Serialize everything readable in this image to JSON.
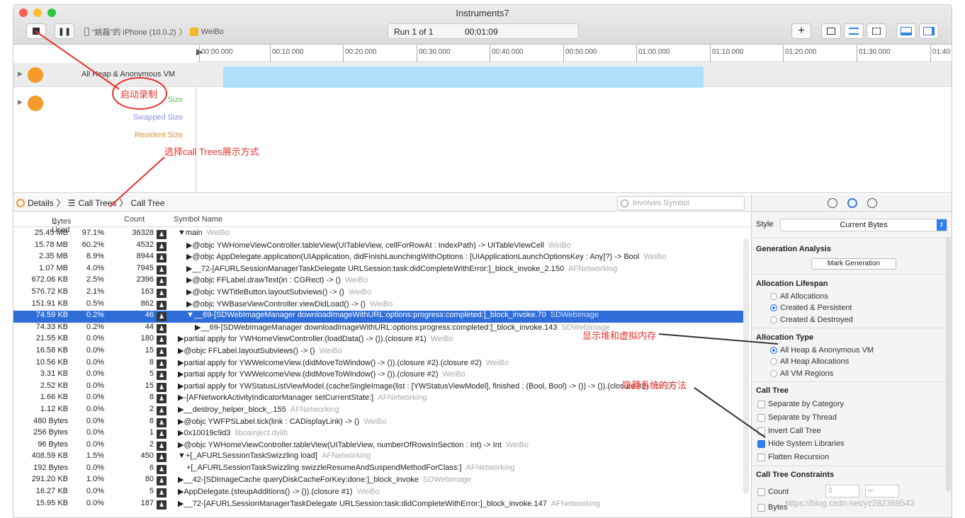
{
  "window": {
    "title": "Instruments7"
  },
  "toolbar": {
    "device": "“姚磊”的 iPhone (10.0.2)",
    "process": "WeiBo",
    "run_label": "Run 1 of 1",
    "timer": "00:01:09"
  },
  "ruler": {
    "ticks": [
      "00:00.000",
      "00:10.000",
      "00:20.000",
      "00:30.000",
      "00:40.000",
      "00:50.000",
      "01:00.000",
      "01:10.000",
      "01:20.000",
      "01:30.000",
      "01:40"
    ]
  },
  "tracks": {
    "main_track": "All Heap & Anonymous VM",
    "sub_labels": [
      "Size",
      "Swapped Size",
      "Resident Size"
    ]
  },
  "annotations": {
    "record": "启动录制",
    "call_trees": "选择call Trees展示方式",
    "heap": "显示堆和虚拟内存",
    "hide_system": "隐藏系统的方法"
  },
  "jumpbar": {
    "details": "Details",
    "call_trees": "Call Trees",
    "call_tree": "Call Tree",
    "search_placeholder": "Involves Symbol"
  },
  "columns": {
    "bytes": "Bytes Used",
    "count": "Count",
    "symbol": "Symbol Name"
  },
  "rows": [
    {
      "bytes": "25.45 MB",
      "pct": "97.1%",
      "count": "36328",
      "sym": "▼main",
      "lib": "WeiBo",
      "indent": 0
    },
    {
      "bytes": "15.78 MB",
      "pct": "60.2%",
      "count": "4532",
      "sym": "▶@objc YWHomeViewController.tableView(UITableView, cellForRowAt : IndexPath) -> UITableViewCell",
      "lib": "WeiBo",
      "indent": 1
    },
    {
      "bytes": "2.35 MB",
      "pct": "8.9%",
      "count": "8944",
      "sym": "▶@objc AppDelegate.application(UIApplication, didFinishLaunchingWithOptions : [UIApplicationLaunchOptionsKey : Any]?) -> Bool",
      "lib": "WeiBo",
      "indent": 1
    },
    {
      "bytes": "1.07 MB",
      "pct": "4.0%",
      "count": "7945",
      "sym": "▶__72-[AFURLSessionManagerTaskDelegate URLSession:task:didCompleteWithError:]_block_invoke_2.150",
      "lib": "AFNetworking",
      "indent": 1
    },
    {
      "bytes": "672.06 KB",
      "pct": "2.5%",
      "count": "2396",
      "sym": "▶@objc FFLabel.drawText(in : CGRect) -> ()",
      "lib": "WeiBo",
      "indent": 1
    },
    {
      "bytes": "576.72 KB",
      "pct": "2.1%",
      "count": "163",
      "sym": "▶@objc YWTitleButton.layoutSubviews() -> ()",
      "lib": "WeiBo",
      "indent": 1
    },
    {
      "bytes": "151.91 KB",
      "pct": "0.5%",
      "count": "862",
      "sym": "▶@objc YWBaseViewController.viewDidLoad() -> ()",
      "lib": "WeiBo",
      "indent": 1
    },
    {
      "bytes": "74.59 KB",
      "pct": "0.2%",
      "count": "46",
      "sym": "▼__69-[SDWebImageManager downloadImageWithURL:options:progress:completed:]_block_invoke.70",
      "lib": "SDWebImage",
      "indent": 1,
      "sel": true
    },
    {
      "bytes": "74.33 KB",
      "pct": "0.2%",
      "count": "44",
      "sym": "▶__69-[SDWebImageManager downloadImageWithURL:options:progress:completed:]_block_invoke.143",
      "lib": "SDWebImage",
      "indent": 2
    },
    {
      "bytes": "21.55 KB",
      "pct": "0.0%",
      "count": "180",
      "sym": "▶partial apply for YWHomeViewController.(loadData() -> ()).(closure #1)",
      "lib": "WeiBo",
      "indent": 0
    },
    {
      "bytes": "16.58 KB",
      "pct": "0.0%",
      "count": "15",
      "sym": "▶@objc FFLabel.layoutSubviews() -> ()",
      "lib": "WeiBo",
      "indent": 0
    },
    {
      "bytes": "10.56 KB",
      "pct": "0.0%",
      "count": "8",
      "sym": "▶partial apply for YWWelcomeView.(didMoveToWindow() -> ()).(closure #2).(closure #2)",
      "lib": "WeiBo",
      "indent": 0
    },
    {
      "bytes": "3.31 KB",
      "pct": "0.0%",
      "count": "5",
      "sym": "▶partial apply for YWWelcomeView.(didMoveToWindow() -> ()).(closure #2)",
      "lib": "WeiBo",
      "indent": 0
    },
    {
      "bytes": "2.52 KB",
      "pct": "0.0%",
      "count": "15",
      "sym": "▶partial apply for YWStatusListViewModel.(cacheSingleImage(list : [YWStatusViewModel], finished : (Bool, Bool) -> ()) -> ()).(closure #2)",
      "lib": "WeiBo",
      "indent": 0
    },
    {
      "bytes": "1.66 KB",
      "pct": "0.0%",
      "count": "8",
      "sym": "▶-[AFNetworkActivityIndicatorManager setCurrentState:]",
      "lib": "AFNetworking",
      "indent": 0
    },
    {
      "bytes": "1.12 KB",
      "pct": "0.0%",
      "count": "2",
      "sym": "▶__destroy_helper_block_.155",
      "lib": "AFNetworking",
      "indent": 0
    },
    {
      "bytes": "480 Bytes",
      "pct": "0.0%",
      "count": "8",
      "sym": "▶@objc YWFPSLabel.tick(link : CADisplayLink) -> ()",
      "lib": "WeiBo",
      "indent": 0
    },
    {
      "bytes": "256 Bytes",
      "pct": "0.0%",
      "count": "1",
      "sym": "▶0x10019c9d3",
      "lib": "liboainject.dylib",
      "indent": 0
    },
    {
      "bytes": "96 Bytes",
      "pct": "0.0%",
      "count": "2",
      "sym": "▶@objc YWHomeViewController.tableView(UITableView, numberOfRowsInSection : Int) -> Int",
      "lib": "WeiBo",
      "indent": 0
    },
    {
      "bytes": "408.59 KB",
      "pct": "1.5%",
      "count": "450",
      "sym": "▼+[_AFURLSessionTaskSwizzling load]",
      "lib": "AFNetworking",
      "indent": 0
    },
    {
      "bytes": "192 Bytes",
      "pct": "0.0%",
      "count": "6",
      "sym": "+[_AFURLSessionTaskSwizzling swizzleResumeAndSuspendMethodForClass:]",
      "lib": "AFNetworking",
      "indent": 1
    },
    {
      "bytes": "291.20 KB",
      "pct": "1.0%",
      "count": "80",
      "sym": "▶__42-[SDImageCache queryDiskCacheForKey:done:]_block_invoke",
      "lib": "SDWebImage",
      "indent": 0
    },
    {
      "bytes": "16.27 KB",
      "pct": "0.0%",
      "count": "5",
      "sym": "▶AppDelegate.(steupAdditions() -> ()).(closure #1)",
      "lib": "WeiBo",
      "indent": 0
    },
    {
      "bytes": "15.95 KB",
      "pct": "0.0%",
      "count": "187",
      "sym": "▶__72-[AFURLSessionManagerTaskDelegate URLSession:task:didCompleteWithError:]_block_invoke.147",
      "lib": "AFNetworking",
      "indent": 0
    }
  ],
  "inspector": {
    "style_label": "Style",
    "style_value": "Current Bytes",
    "gen_title": "Generation Analysis",
    "mark_generation": "Mark Generation",
    "lifespan_title": "Allocation Lifespan",
    "lifespan": [
      "All Allocations",
      "Created & Persistent",
      "Created & Destroyed"
    ],
    "type_title": "Allocation Type",
    "types": [
      "All Heap & Anonymous VM",
      "All Heap Allocations",
      "All VM Regions"
    ],
    "calltree_title": "Call Tree",
    "calltree_opts": [
      "Separate by Category",
      "Separate by Thread",
      "Invert Call Tree",
      "Hide System Libraries",
      "Flatten Recursion"
    ],
    "constraints_title": "Call Tree Constraints",
    "count_label": "Count",
    "bytes_label": "Bytes",
    "min_value": "0",
    "max_value": "∞"
  },
  "watermark": "https://blog.csdn.net/yz282389543"
}
